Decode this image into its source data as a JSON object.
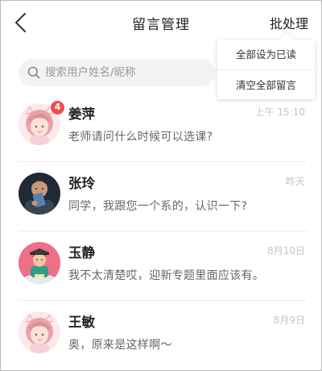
{
  "header": {
    "title": "留言管理",
    "batch_label": "批处理"
  },
  "dropdown": {
    "items": [
      {
        "label": "全部设为已读"
      },
      {
        "label": "清空全部留言"
      }
    ]
  },
  "search": {
    "placeholder": "搜索用户姓名/昵称",
    "value": ""
  },
  "messages": [
    {
      "name": "姜萍",
      "time": "上午 15:10",
      "preview": "老师请问什么时候可以选课?",
      "unread": "4",
      "avatar": "girl-with-cat-ears-avatar"
    },
    {
      "name": "张玲",
      "time": "昨天",
      "preview": "同学，我跟您一个系的，认识一下?",
      "avatar": "man-holding-card-avatar"
    },
    {
      "name": "玉静",
      "time": "8月10日",
      "preview": "我不太清楚哎，迎新专题里面应该有。",
      "avatar": "cartoon-student-avatar"
    },
    {
      "name": "王敏",
      "time": "8月9日",
      "preview": "奥，原来是这样啊～",
      "avatar": "girl-with-cat-ears-avatar"
    }
  ],
  "colors": {
    "badge": "#f04e4e",
    "time": "#c4c4c4",
    "preview": "#666666",
    "search_bg": "#f3f3f3"
  }
}
